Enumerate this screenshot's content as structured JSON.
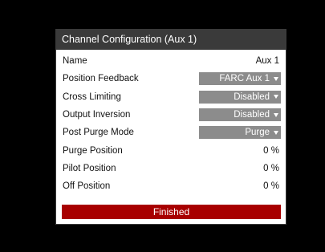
{
  "dialog": {
    "title": "Channel Configuration  (Aux 1)",
    "rows": [
      {
        "label": "Name",
        "value": "Aux 1"
      },
      {
        "label": "Position Feedback",
        "value": "FARC Aux 1"
      },
      {
        "label": "Cross Limiting",
        "value": "Disabled"
      },
      {
        "label": "Output Inversion",
        "value": "Disabled"
      },
      {
        "label": "Post Purge Mode",
        "value": "Purge"
      },
      {
        "label": "Purge Position",
        "value": "0 %"
      },
      {
        "label": "Pilot Position",
        "value": "0 %"
      },
      {
        "label": "Off Position",
        "value": "0 %"
      }
    ],
    "finished_label": "Finished"
  },
  "colors": {
    "background": "#000000",
    "title_bar": "#3a3a3a",
    "dropdown": "#8c8c8c",
    "finished_button": "#a80000"
  },
  "icons": {
    "dropdown_caret": "caret-down-icon"
  }
}
